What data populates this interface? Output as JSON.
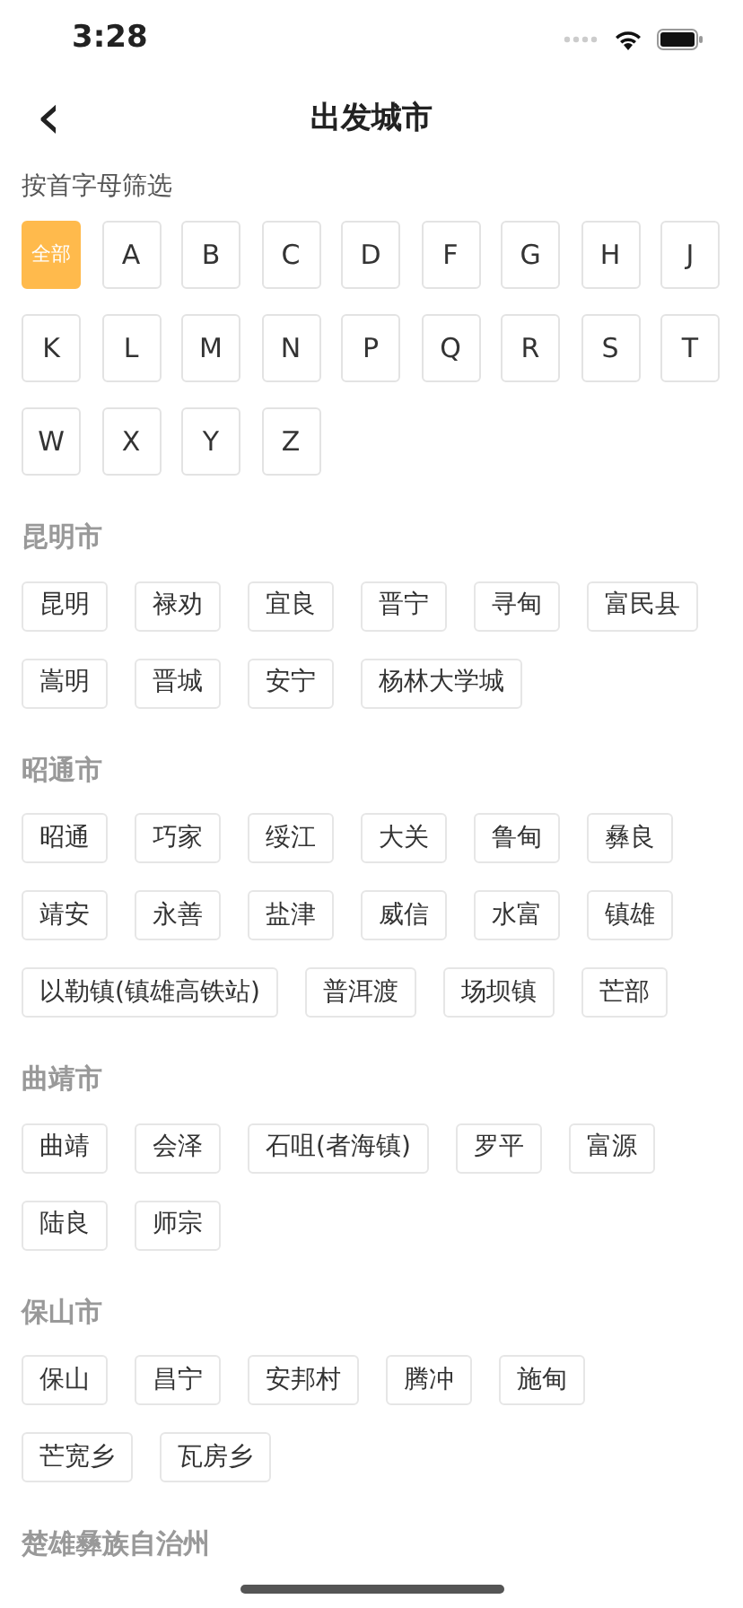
{
  "status_bar": {
    "time": "3:28"
  },
  "header": {
    "back": "‹",
    "title": "出发城市"
  },
  "filter": {
    "label": "按首字母筛选",
    "letters": [
      {
        "label": "全部",
        "selected": true
      },
      {
        "label": "A",
        "selected": false
      },
      {
        "label": "B",
        "selected": false
      },
      {
        "label": "C",
        "selected": false
      },
      {
        "label": "D",
        "selected": false
      },
      {
        "label": "F",
        "selected": false
      },
      {
        "label": "G",
        "selected": false
      },
      {
        "label": "H",
        "selected": false
      },
      {
        "label": "J",
        "selected": false
      },
      {
        "label": "K",
        "selected": false
      },
      {
        "label": "L",
        "selected": false
      },
      {
        "label": "M",
        "selected": false
      },
      {
        "label": "N",
        "selected": false
      },
      {
        "label": "P",
        "selected": false
      },
      {
        "label": "Q",
        "selected": false
      },
      {
        "label": "R",
        "selected": false
      },
      {
        "label": "S",
        "selected": false
      },
      {
        "label": "T",
        "selected": false
      },
      {
        "label": "W",
        "selected": false
      },
      {
        "label": "X",
        "selected": false
      },
      {
        "label": "Y",
        "selected": false
      },
      {
        "label": "Z",
        "selected": false
      }
    ]
  },
  "sections": [
    {
      "title": "昆明市",
      "cities": [
        "昆明",
        "禄劝",
        "宜良",
        "晋宁",
        "寻甸",
        "富民县",
        "嵩明",
        "晋城",
        "安宁",
        "杨林大学城"
      ]
    },
    {
      "title": "昭通市",
      "cities": [
        "昭通",
        "巧家",
        "绥江",
        "大关",
        "鲁甸",
        "彝良",
        "靖安",
        "永善",
        "盐津",
        "威信",
        "水富",
        "镇雄",
        "以勒镇(镇雄高铁站)",
        "普洱渡",
        "场坝镇",
        "芒部"
      ]
    },
    {
      "title": "曲靖市",
      "cities": [
        "曲靖",
        "会泽",
        "石咀(者海镇)",
        "罗平",
        "富源",
        "陆良",
        "师宗"
      ]
    },
    {
      "title": "保山市",
      "cities": [
        "保山",
        "昌宁",
        "安邦村",
        "腾冲",
        "施甸",
        "芒宽乡",
        "瓦房乡"
      ]
    },
    {
      "title": "楚雄彝族自治州"
    }
  ]
}
